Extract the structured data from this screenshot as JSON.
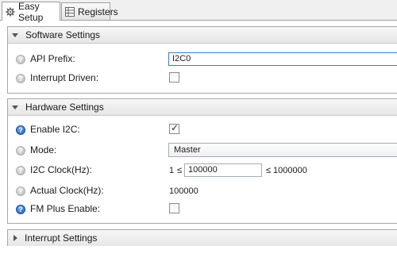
{
  "tabs": [
    {
      "label": "Easy Setup",
      "icon": "gear-icon",
      "active": true
    },
    {
      "label": "Registers",
      "icon": "table-icon",
      "active": false
    }
  ],
  "software_settings": {
    "title": "Software Settings",
    "api_prefix_label": "API Prefix:",
    "api_prefix_value": "I2C0",
    "interrupt_driven_label": "Interrupt Driven:",
    "interrupt_driven_checked": false
  },
  "hardware_settings": {
    "title": "Hardware Settings",
    "enable_label": "Enable I2C:",
    "enable_checked": true,
    "mode_label": "Mode:",
    "mode_value": "Master",
    "clock_label": "I2C Clock(Hz):",
    "clock_min": "1",
    "clock_le1": "≤",
    "clock_value": "100000",
    "clock_le2": "≤",
    "clock_max": "1000000",
    "actual_clock_label": "Actual Clock(Hz):",
    "actual_clock_value": "100000",
    "fm_plus_label": "FM Plus Enable:",
    "fm_plus_checked": false
  },
  "interrupt_settings": {
    "title": "Interrupt Settings"
  },
  "icon_colors": {
    "help_grey": "#b4b4b4",
    "help_blue": "#1f5fb5"
  }
}
